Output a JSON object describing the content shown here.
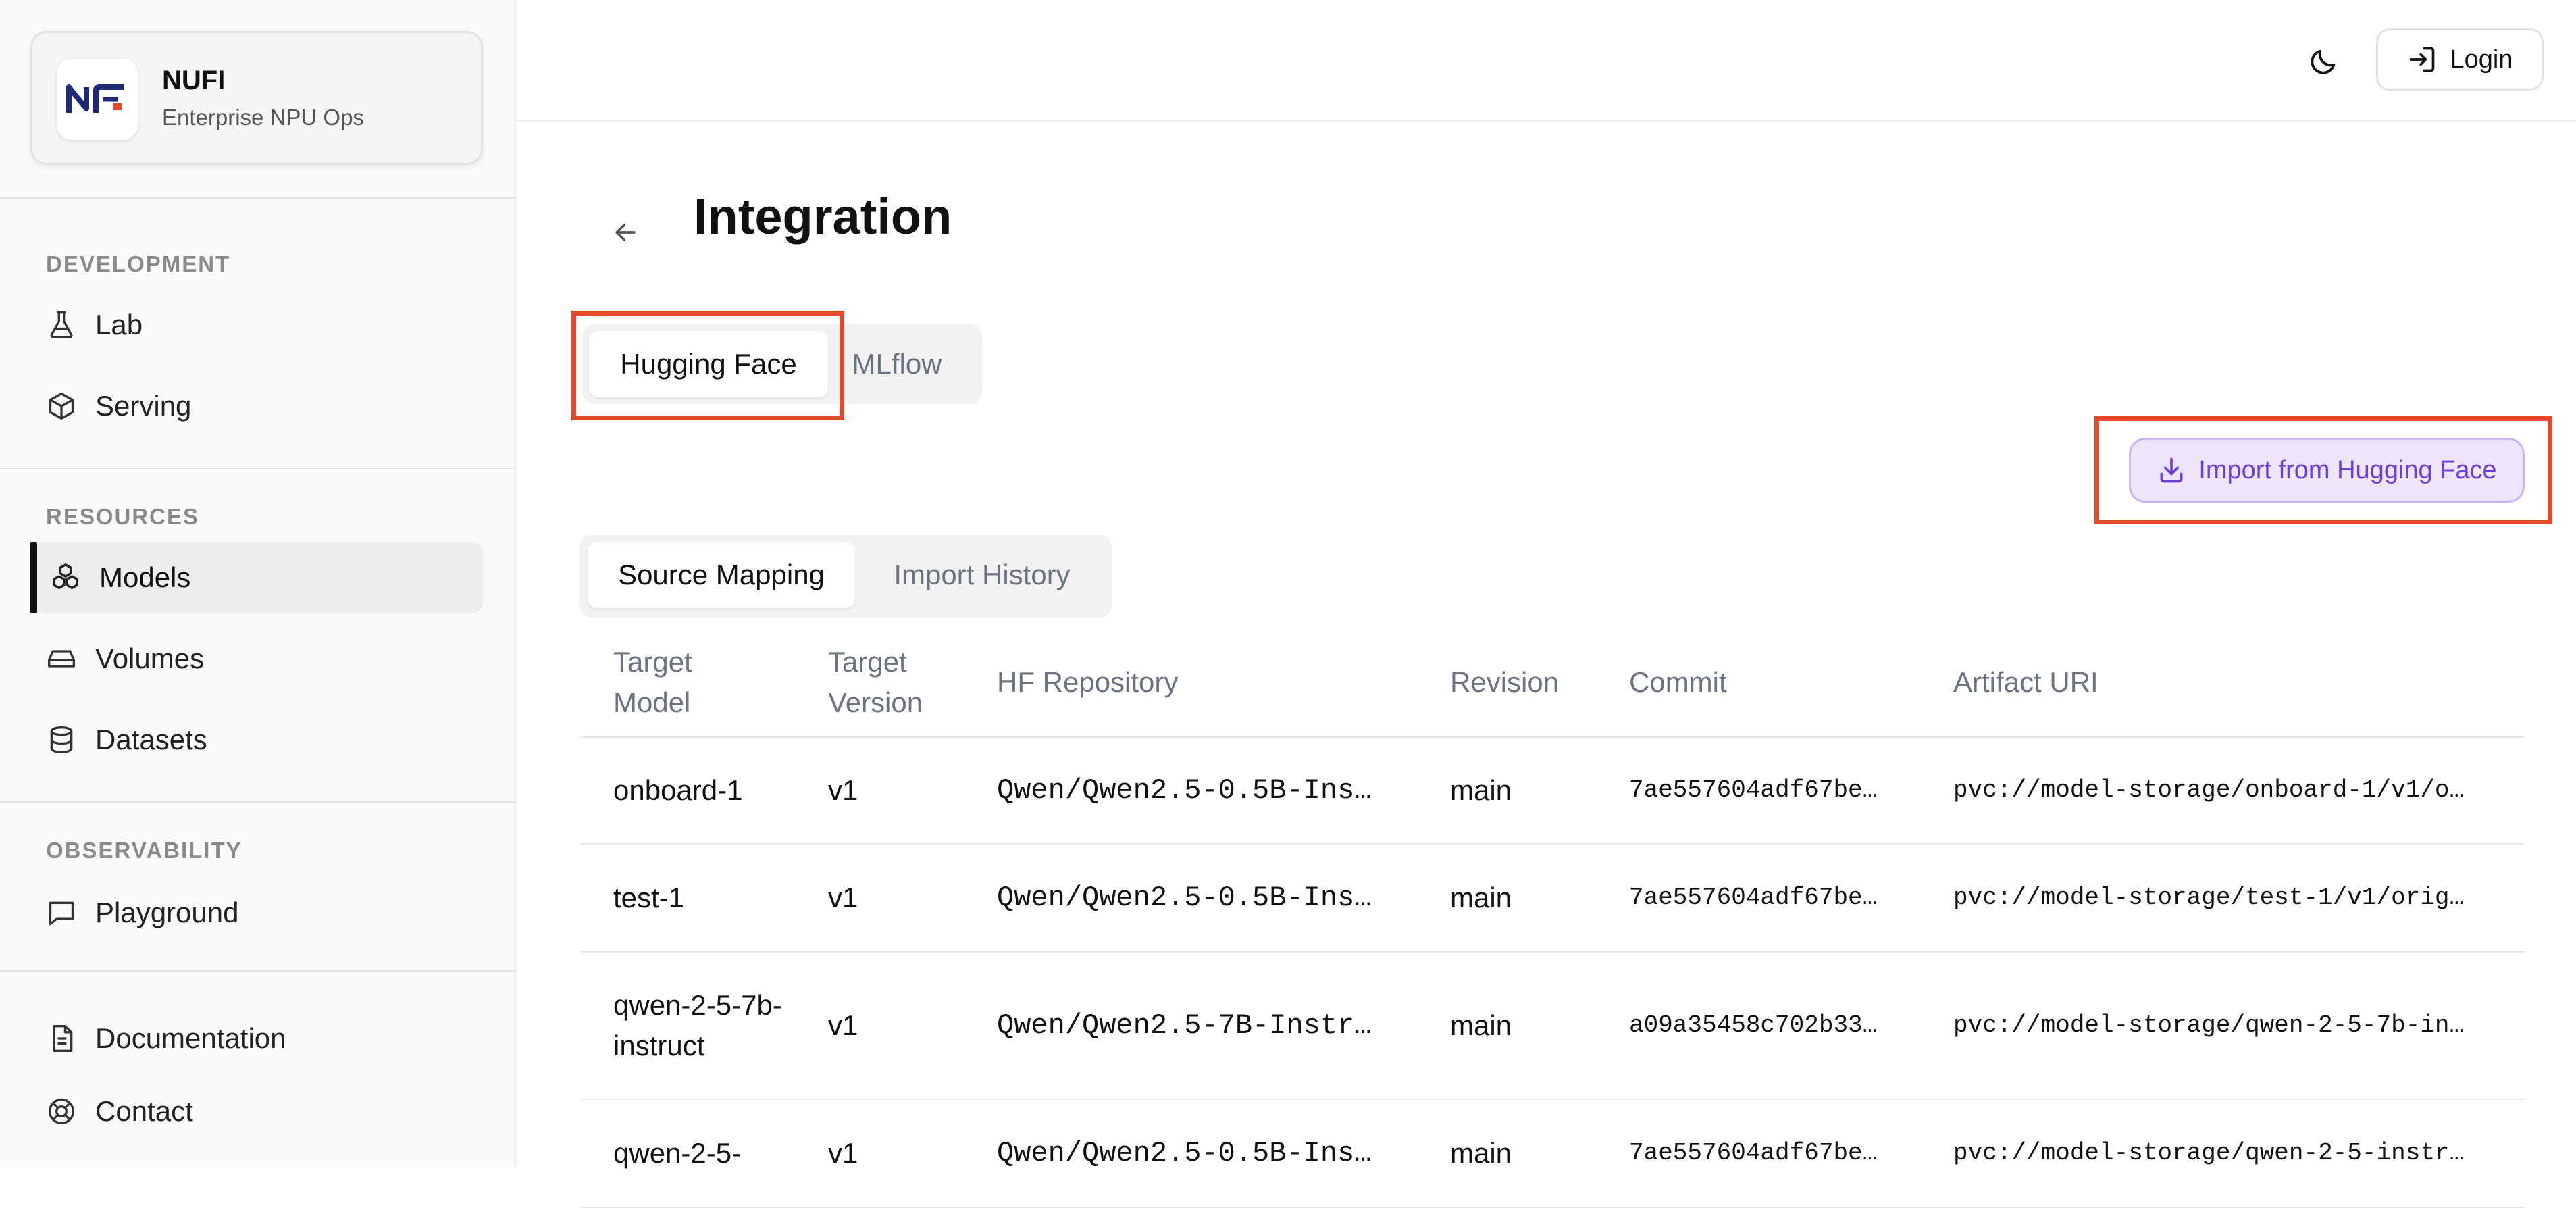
{
  "brand": {
    "name": "NUFI",
    "subtitle": "Enterprise NPU Ops"
  },
  "sidebar": {
    "sections": [
      {
        "label": "DEVELOPMENT",
        "items": [
          {
            "label": "Lab",
            "icon": "flask-icon"
          },
          {
            "label": "Serving",
            "icon": "cube-icon"
          }
        ]
      },
      {
        "label": "RESOURCES",
        "items": [
          {
            "label": "Models",
            "icon": "models-icon",
            "active": true
          },
          {
            "label": "Volumes",
            "icon": "drive-icon"
          },
          {
            "label": "Datasets",
            "icon": "database-icon"
          }
        ]
      },
      {
        "label": "OBSERVABILITY",
        "items": [
          {
            "label": "Playground",
            "icon": "chat-icon"
          }
        ]
      }
    ],
    "footer_items": [
      {
        "label": "Documentation",
        "icon": "document-icon"
      },
      {
        "label": "Contact",
        "icon": "lifebuoy-icon"
      }
    ]
  },
  "header": {
    "login_label": "Login",
    "theme_icon": "moon-icon"
  },
  "page": {
    "title": "Integration"
  },
  "tabs": [
    {
      "label": "Hugging Face",
      "active": true
    },
    {
      "label": "MLflow",
      "active": false
    }
  ],
  "import_button": {
    "label": "Import from Hugging Face",
    "icon": "download-icon"
  },
  "subtabs": [
    {
      "label": "Source Mapping",
      "active": true
    },
    {
      "label": "Import History",
      "active": false
    }
  ],
  "table": {
    "columns": [
      "Target\nModel",
      "Target\nVersion",
      "HF Repository",
      "Revision",
      "Commit",
      "Artifact URI"
    ],
    "rows": [
      {
        "model": "onboard-1",
        "version": "v1",
        "repo": "Qwen/Qwen2.5-0.5B-Ins…",
        "revision": "main",
        "commit": "7ae557604adf67be…",
        "uri": "pvc://model-storage/onboard-1/v1/o…"
      },
      {
        "model": "test-1",
        "version": "v1",
        "repo": "Qwen/Qwen2.5-0.5B-Ins…",
        "revision": "main",
        "commit": "7ae557604adf67be…",
        "uri": "pvc://model-storage/test-1/v1/orig…"
      },
      {
        "model": "qwen-2-5-7b-instruct",
        "version": "v1",
        "repo": "Qwen/Qwen2.5-7B-Instr…",
        "revision": "main",
        "commit": "a09a35458c702b33…",
        "uri": "pvc://model-storage/qwen-2-5-7b-in…"
      },
      {
        "model": "qwen-2-5-",
        "version": "v1",
        "repo": "Qwen/Qwen2.5-0.5B-Ins…",
        "revision": "main",
        "commit": "7ae557604adf67be…",
        "uri": "pvc://model-storage/qwen-2-5-instr…"
      }
    ]
  }
}
